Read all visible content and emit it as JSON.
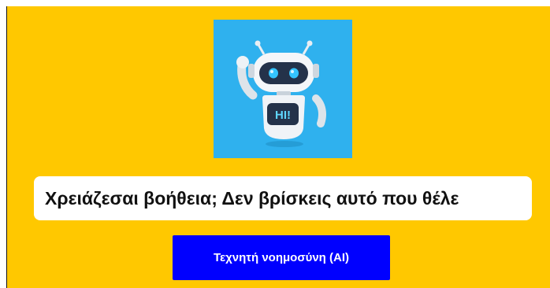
{
  "bot_image": {
    "icon": "robot-waving-icon",
    "screen_text": "HI!",
    "background_color": "#2fb1ee"
  },
  "chat": {
    "message": "Χρειάζεσαι βοήθεια; Δεν βρίσκεις αυτό που θέλε"
  },
  "actions": {
    "ai_button_label": "Τεχνητή νοημοσύνη (AI)"
  },
  "colors": {
    "page_background": "#ffc800",
    "button": "#0000ff",
    "button_text": "#ffffff"
  }
}
